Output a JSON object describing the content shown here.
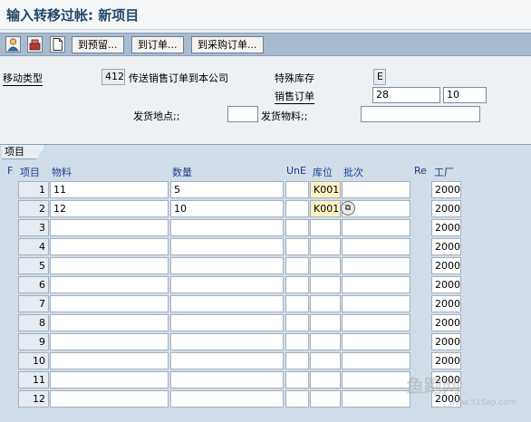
{
  "window": {
    "title": "输入转移过帐: 新项目"
  },
  "toolbar": {
    "icons": [
      "person-icon",
      "cash-register-icon",
      "new-document-icon"
    ],
    "buttons": [
      "到预留...",
      "到订单...",
      "到采购订单..."
    ]
  },
  "header": {
    "movement_type_label": "移动类型",
    "movement_type_value": "412",
    "movement_type_text": "传送销售订单到本公司",
    "special_stock_label": "特殊库存",
    "special_stock_value": "E",
    "sales_order_label": "销售订单",
    "sales_order_value": "28",
    "sales_order_item": "10",
    "issue_plant_label": "发货地点;;",
    "issue_plant_value": "",
    "issue_material_label": "发货物料;;",
    "issue_material_value": ""
  },
  "items": {
    "tab_label": "项目",
    "columns": {
      "flag": "F",
      "item": "项目",
      "material": "物料",
      "quantity": "数量",
      "uoe": "UnE",
      "sloc": "库位",
      "batch": "批次",
      "re": "Re",
      "plant": "工厂"
    },
    "rows": [
      {
        "num": "1",
        "material": "11",
        "quantity": "5",
        "uoe": "",
        "sloc": "K001",
        "batch": "",
        "plant": "2000"
      },
      {
        "num": "2",
        "material": "12",
        "quantity": "10",
        "uoe": "",
        "sloc": "K001",
        "batch": "",
        "plant": "2000"
      },
      {
        "num": "3",
        "material": "",
        "quantity": "",
        "uoe": "",
        "sloc": "",
        "batch": "",
        "plant": "2000"
      },
      {
        "num": "4",
        "material": "",
        "quantity": "",
        "uoe": "",
        "sloc": "",
        "batch": "",
        "plant": "2000"
      },
      {
        "num": "5",
        "material": "",
        "quantity": "",
        "uoe": "",
        "sloc": "",
        "batch": "",
        "plant": "2000"
      },
      {
        "num": "6",
        "material": "",
        "quantity": "",
        "uoe": "",
        "sloc": "",
        "batch": "",
        "plant": "2000"
      },
      {
        "num": "7",
        "material": "",
        "quantity": "",
        "uoe": "",
        "sloc": "",
        "batch": "",
        "plant": "2000"
      },
      {
        "num": "8",
        "material": "",
        "quantity": "",
        "uoe": "",
        "sloc": "",
        "batch": "",
        "plant": "2000"
      },
      {
        "num": "9",
        "material": "",
        "quantity": "",
        "uoe": "",
        "sloc": "",
        "batch": "",
        "plant": "2000"
      },
      {
        "num": "10",
        "material": "",
        "quantity": "",
        "uoe": "",
        "sloc": "",
        "batch": "",
        "plant": "2000"
      },
      {
        "num": "11",
        "material": "",
        "quantity": "",
        "uoe": "",
        "sloc": "",
        "batch": "",
        "plant": "2000"
      },
      {
        "num": "12",
        "material": "",
        "quantity": "",
        "uoe": "",
        "sloc": "",
        "batch": "",
        "plant": "2000"
      }
    ]
  },
  "watermark": {
    "logo": "鱼跑网",
    "url": "www.51Sap.com"
  },
  "colors": {
    "title": "#24476b",
    "toolbar": "#a9bbd0",
    "section": "#d1dde9",
    "column_header": "#1d3f8f",
    "highlight": "#fff3c4"
  }
}
